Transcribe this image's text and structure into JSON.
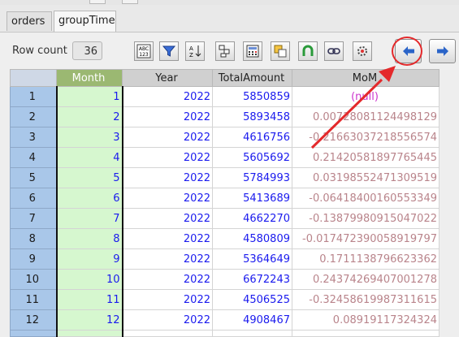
{
  "tabs": [
    {
      "label": "orders"
    },
    {
      "label": "groupTime"
    }
  ],
  "toolbar": {
    "rowcount_label": "Row count",
    "rowcount_value": "36",
    "buttons": [
      {
        "name": "abc-123-format-icon"
      },
      {
        "name": "filter-icon"
      },
      {
        "name": "sort-az-icon"
      },
      {
        "name": "group-icon"
      },
      {
        "name": "calculator-icon"
      },
      {
        "name": "copy-column-icon"
      },
      {
        "name": "magnet-icon"
      },
      {
        "name": "link-icon"
      },
      {
        "name": "settings-gear-icon"
      }
    ],
    "nav_prev": "left-arrow-icon",
    "nav_next": "right-arrow-icon"
  },
  "colors": {
    "month_header": "#9bb872",
    "month_cell": "#d6f7cf",
    "rownum": "#a9c7e9",
    "value_text": "#1a1aee",
    "mom_text": "#b9848b",
    "null_text": "#cc33cc",
    "annotation": "#e4292b"
  },
  "grid": {
    "columns": [
      "Month",
      "Year",
      "TotalAmount",
      "MoM"
    ],
    "rows": [
      {
        "n": "1",
        "month": "1",
        "year": "2022",
        "total": "5850859",
        "mom": "(null)"
      },
      {
        "n": "2",
        "month": "2",
        "year": "2022",
        "total": "5893458",
        "mom": "0.00728081124498129"
      },
      {
        "n": "3",
        "month": "3",
        "year": "2022",
        "total": "4616756",
        "mom": "-0.21663037218556574"
      },
      {
        "n": "4",
        "month": "4",
        "year": "2022",
        "total": "5605692",
        "mom": "0.21420581897765445"
      },
      {
        "n": "5",
        "month": "5",
        "year": "2022",
        "total": "5784993",
        "mom": "0.03198552471309519"
      },
      {
        "n": "6",
        "month": "6",
        "year": "2022",
        "total": "5413689",
        "mom": "-0.06418400160553349"
      },
      {
        "n": "7",
        "month": "7",
        "year": "2022",
        "total": "4662270",
        "mom": "-0.13879980915047022"
      },
      {
        "n": "8",
        "month": "8",
        "year": "2022",
        "total": "4580809",
        "mom": "-0.017472390058919797"
      },
      {
        "n": "9",
        "month": "9",
        "year": "2022",
        "total": "5364649",
        "mom": "0.1711138796623362"
      },
      {
        "n": "10",
        "month": "10",
        "year": "2022",
        "total": "6672243",
        "mom": "0.24374269407001278"
      },
      {
        "n": "11",
        "month": "11",
        "year": "2022",
        "total": "4506525",
        "mom": "-0.32458619987311615"
      },
      {
        "n": "12",
        "month": "12",
        "year": "2022",
        "total": "4908467",
        "mom": "0.08919117324324"
      }
    ]
  }
}
